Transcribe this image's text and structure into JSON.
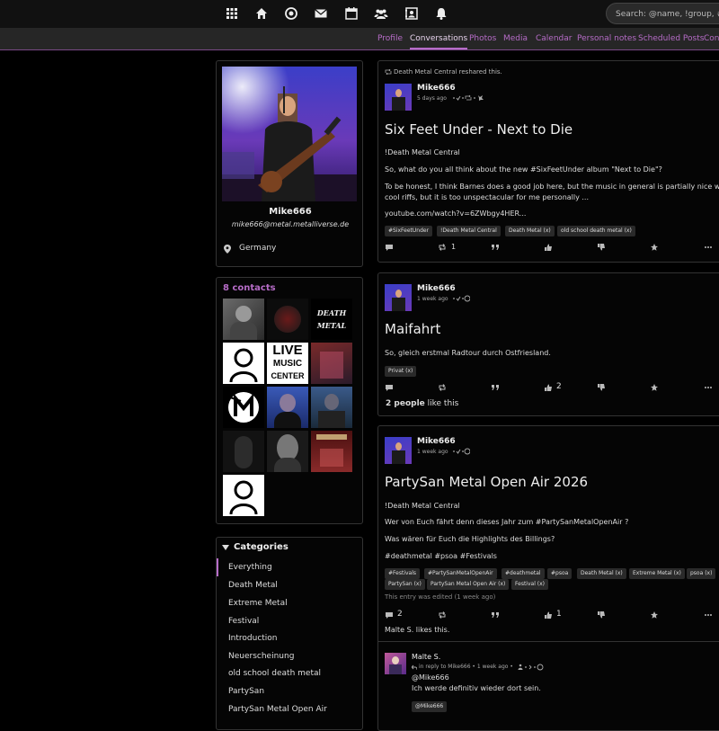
{
  "topnav": {
    "icons": [
      "apps-icon",
      "home-icon",
      "community-icon",
      "mail-icon",
      "calendar-icon",
      "contacts-icon",
      "directory-icon",
      "bell-icon"
    ],
    "search_placeholder": "Search: @name, !group, #tags, content"
  },
  "tabs": [
    "Profile",
    "Conversations",
    "Photos",
    "Media",
    "Calendar",
    "Personal notes",
    "Scheduled Posts",
    "Contacts"
  ],
  "active_tab": "Conversations",
  "profile": {
    "name": "Mike666",
    "address": "mike666@metal.metalliverse.de",
    "location": "Germany"
  },
  "contacts": {
    "title": "8 contacts",
    "live_line1": "LIVE",
    "live_line2": "MUSIC",
    "live_line3": "CENTER",
    "death_line1": "DEATH",
    "death_line2": "METAL"
  },
  "categories": {
    "title": "Categories",
    "items": [
      "Everything",
      "Death Metal",
      "Extreme Metal",
      "Festival",
      "Introduction",
      "Neuerscheinung",
      "old school death metal",
      "PartySan",
      "PartySan Metal Open Air"
    ]
  },
  "posts": [
    {
      "reshare": "Death Metal Central reshared this.",
      "author": "Mike666",
      "time": "5 days ago",
      "title": "Six Feet Under - Next to Die",
      "group": "!Death Metal Central",
      "p1": "So, what do you all think about the new #SixFeetUnder album \"Next to Die\"?",
      "p2a": "To be honest, I think Barnes does a good job here, but the music in general is partially nice with",
      "p2b": "cool riffs, but it is too unspectacular for me personally ...",
      "link": "youtube.com/watch?v=6ZWbgy4HER...",
      "tags": [
        "#SixFeetUnder",
        "!Death Metal Central",
        "Death Metal (x)",
        "old school death metal (x)"
      ],
      "reshare_count": "1"
    },
    {
      "author": "Mike666",
      "time": "1 week ago",
      "title": "Maifahrt",
      "text": "So, gleich erstmal Radtour durch Ostfriesland.",
      "tags": [
        "Privat (x)"
      ],
      "like_count": "2",
      "likes_bold": "2 people",
      "likes_rest": "like this"
    },
    {
      "author": "Mike666",
      "time": "1 week ago",
      "title": "PartySan Metal Open Air 2026",
      "group": "!Death Metal Central",
      "p1": "Wer von Euch fährt denn dieses Jahr zum #PartySanMetalOpenAir ?",
      "p2": "Was wären für Euch die Highlights des Billings?",
      "p3": "#deathmetal #psoa #Festivals",
      "tags_row1": [
        "#Festivals",
        "#PartySanMetalOpenAir",
        "#deathmetal",
        "#psoa",
        "Death Metal (x)",
        "Extreme Metal (x)",
        "psoa (x)"
      ],
      "tags_row2": [
        "PartySan (x)",
        "PartySan Metal Open Air (x)",
        "Festival (x)"
      ],
      "edited": "This entry was edited (1 week ago)",
      "comment_count": "2",
      "like_count": "1",
      "likes_line": "Malte S. likes this."
    }
  ],
  "comment": {
    "author": "Malte S.",
    "meta": "in reply to Mike666 • 1 week ago •",
    "mention": "@Mike666",
    "text": "Ich werde definitiv wieder dort sein.",
    "tag": "@Mike666"
  }
}
